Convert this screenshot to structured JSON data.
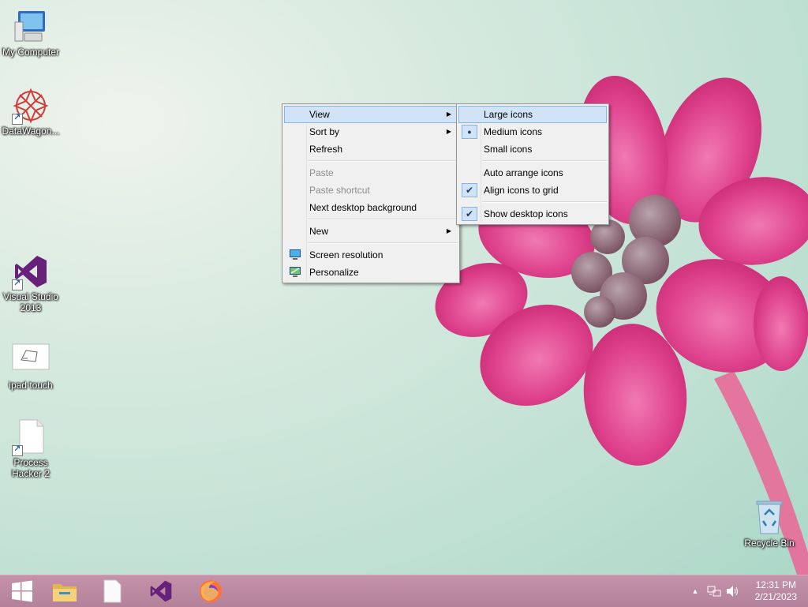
{
  "desktop": {
    "icons": [
      {
        "label": "My Computer",
        "icon": "computer-icon"
      },
      {
        "label": "DataWagon...",
        "icon": "datawagon-icon"
      },
      {
        "label": "Visual Studio 2013",
        "icon": "visual-studio-icon"
      },
      {
        "label": "ipad touch",
        "icon": "ipad-touch-icon"
      },
      {
        "label": "Process Hacker 2",
        "icon": "process-hacker-icon"
      },
      {
        "label": "Recycle Bin",
        "icon": "recycle-bin-icon"
      }
    ]
  },
  "context_menu": {
    "items": [
      {
        "label": "View",
        "submenu": true,
        "highlighted": true
      },
      {
        "label": "Sort by",
        "submenu": true
      },
      {
        "label": "Refresh"
      },
      {
        "label": "Paste",
        "disabled": true
      },
      {
        "label": "Paste shortcut",
        "disabled": true
      },
      {
        "label": "Next desktop background"
      },
      {
        "label": "New",
        "submenu": true
      },
      {
        "label": "Screen resolution",
        "icon": "screen-resolution-icon"
      },
      {
        "label": "Personalize",
        "icon": "personalize-icon"
      }
    ]
  },
  "view_submenu": {
    "items": [
      {
        "label": "Large icons",
        "highlighted": true
      },
      {
        "label": "Medium icons",
        "mark": "bullet"
      },
      {
        "label": "Small icons"
      },
      {
        "label": "Auto arrange icons"
      },
      {
        "label": "Align icons to grid",
        "mark": "check"
      },
      {
        "label": "Show desktop icons",
        "mark": "check"
      }
    ],
    "bullet_glyph": "●",
    "check_glyph": "✔"
  },
  "taskbar": {
    "buttons": [
      "start-icon",
      "file-explorer-icon",
      "blank-document-icon",
      "visual-studio-icon",
      "firefox-icon"
    ],
    "tray_icons": [
      "show-hidden-icons-chevron-icon",
      "network-icon",
      "volume-icon"
    ],
    "clock": {
      "time": "12:31 PM",
      "date": "2/21/2023"
    }
  },
  "colors": {
    "menu_highlight": "#d1e3f6",
    "menu_highlight_border": "#84b5e8",
    "taskbar": "#b3829a",
    "flower": "#e0458f"
  }
}
